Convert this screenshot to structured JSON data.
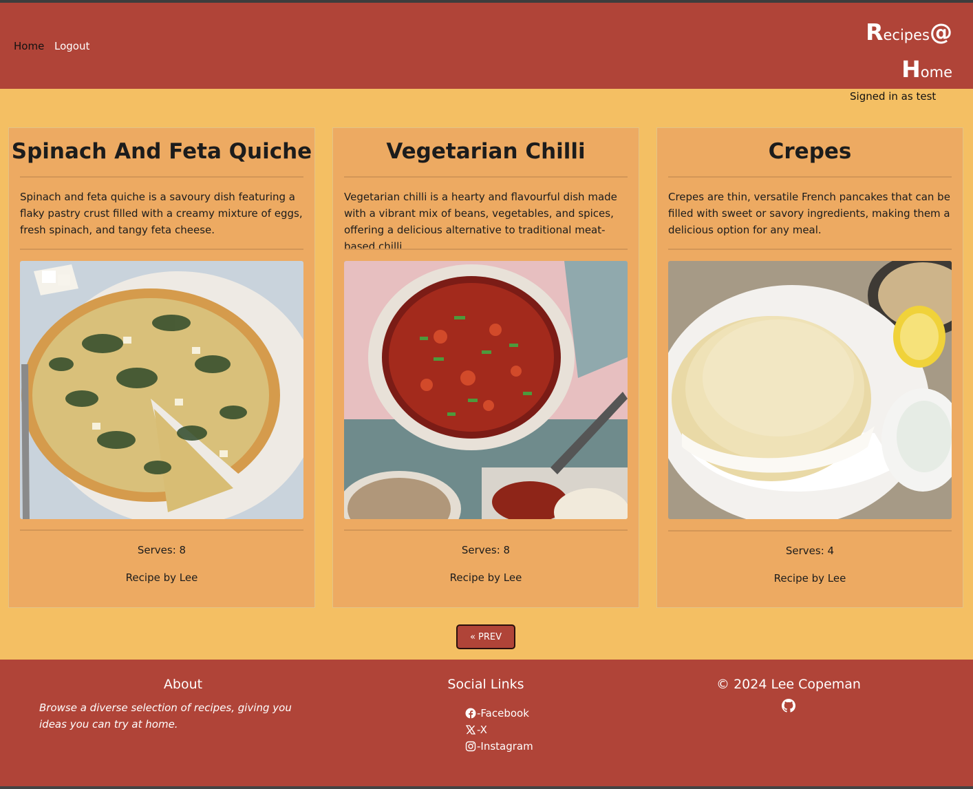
{
  "header": {
    "nav": {
      "home": "Home",
      "logout": "Logout"
    },
    "brand": {
      "r": "R",
      "ecipes": "ecipes",
      "at": "@",
      "h": "H",
      "ome": "ome"
    },
    "signed_in": "Signed in as test"
  },
  "recipes": [
    {
      "title": "Spinach And Feta Quiche",
      "description": "Spinach and feta quiche is a savoury dish featuring a flaky pastry crust filled with a creamy mixture of eggs, fresh spinach, and tangy feta cheese.",
      "serves": "Serves: 8",
      "author": "Recipe by Lee",
      "image": "quiche-photo"
    },
    {
      "title": "Vegetarian Chilli",
      "description": "Vegetarian chilli is a hearty and flavourful dish made with a vibrant mix of beans, vegetables, and spices, offering a delicious alternative to traditional meat-based chilli.",
      "serves": "Serves: 8",
      "author": "Recipe by Lee",
      "image": "chilli-photo"
    },
    {
      "title": "Crepes",
      "description": "Crepes are thin, versatile French pancakes that can be filled with sweet or savory ingredients, making them a delicious option for any meal.",
      "serves": "Serves: 4",
      "author": "Recipe by Lee",
      "image": "crepes-photo"
    }
  ],
  "pagination": {
    "prev": "« PREV"
  },
  "footer": {
    "about_title": "About",
    "about_text": "Browse a diverse selection of recipes, giving you ideas you can try at home.",
    "social_title": "Social Links",
    "social": [
      {
        "label": "-Facebook",
        "icon": "facebook-icon"
      },
      {
        "label": "-X",
        "icon": "x-icon"
      },
      {
        "label": "-Instagram",
        "icon": "instagram-icon"
      }
    ],
    "copyright": "© 2024 Lee Copeman",
    "github_icon": "github-icon"
  },
  "colors": {
    "header_bg": "#b04438",
    "page_bg": "#f4bf63",
    "card_bg": "#edaa62"
  }
}
